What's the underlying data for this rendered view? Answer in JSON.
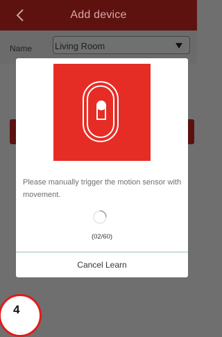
{
  "header": {
    "title": "Add device",
    "back_icon": "chevron-left-icon"
  },
  "form": {
    "name_label": "Name",
    "name_value": "Living Room",
    "dropdown_icon": "triangle-down-icon"
  },
  "dialog": {
    "image_icon": "motion-sensor-icon",
    "image_color": "#e52d25",
    "message": "Please manually trigger the motion sensor with movement.",
    "progress": "(02/60)",
    "cancel_label": "Cancel Learn"
  },
  "badge": {
    "step": "4",
    "color": "#e21a1a"
  }
}
